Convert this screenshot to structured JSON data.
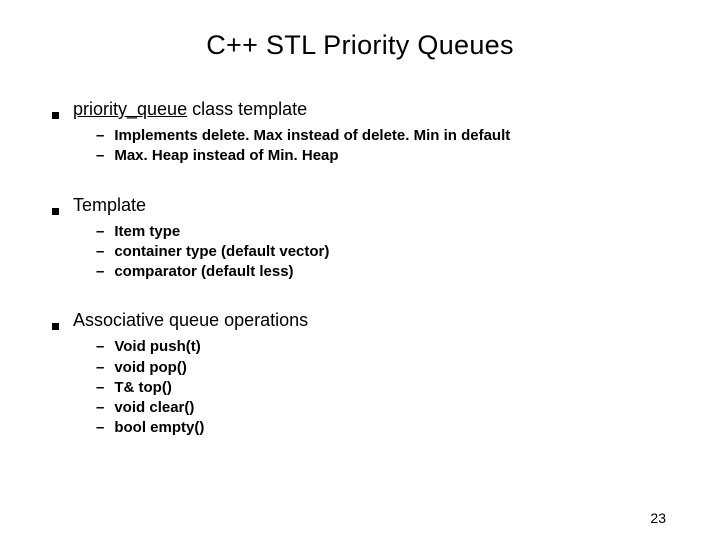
{
  "title": "C++ STL Priority Queues",
  "sections": [
    {
      "label_prefix": "priority_queue",
      "label_rest": " class template",
      "items": [
        "Implements delete. Max instead of delete. Min in default",
        "Max. Heap instead of Min. Heap"
      ]
    },
    {
      "label_prefix": "",
      "label_rest": "Template",
      "items": [
        "Item type",
        "container type (default vector)",
        "comparator (default less)"
      ]
    },
    {
      "label_prefix": "",
      "label_rest": "Associative queue operations",
      "items": [
        "Void push(t)",
        "void pop()",
        "T& top()",
        "void clear()",
        "bool empty()"
      ]
    }
  ],
  "page_number": "23"
}
